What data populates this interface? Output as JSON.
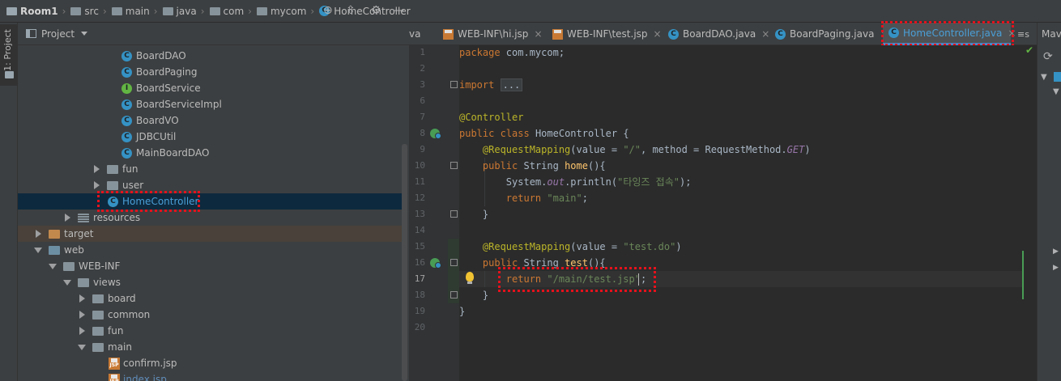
{
  "breadcrumb": [
    "Room1",
    "src",
    "main",
    "java",
    "com",
    "mycom",
    "HomeController"
  ],
  "left_stripe": {
    "tab_label": "1: Project"
  },
  "project_panel": {
    "title": "Project",
    "tree": [
      {
        "label": "BoardDAO",
        "icon": "class-icon"
      },
      {
        "label": "BoardPaging",
        "icon": "class-icon"
      },
      {
        "label": "BoardService",
        "icon": "interface-icon"
      },
      {
        "label": "BoardServiceImpl",
        "icon": "class-icon"
      },
      {
        "label": "BoardVO",
        "icon": "class-icon"
      },
      {
        "label": "JDBCUtil",
        "icon": "class-icon"
      },
      {
        "label": "MainBoardDAO",
        "icon": "class-icon"
      },
      {
        "label": "fun",
        "icon": "folder-icon"
      },
      {
        "label": "user",
        "icon": "folder-icon"
      },
      {
        "label": "HomeController",
        "icon": "class-icon"
      },
      {
        "label": "resources",
        "icon": "resources-folder-icon"
      },
      {
        "label": "target",
        "icon": "folder-icon"
      },
      {
        "label": "web",
        "icon": "web-folder-icon"
      },
      {
        "label": "WEB-INF",
        "icon": "folder-icon"
      },
      {
        "label": "views",
        "icon": "folder-icon"
      },
      {
        "label": "board",
        "icon": "folder-icon"
      },
      {
        "label": "common",
        "icon": "folder-icon"
      },
      {
        "label": "fun",
        "icon": "folder-icon"
      },
      {
        "label": "main",
        "icon": "folder-icon"
      },
      {
        "label": "confirm.jsp",
        "icon": "jsp-icon"
      },
      {
        "label": "index.jsp",
        "icon": "jsp-icon"
      }
    ]
  },
  "tabs": [
    {
      "label": "va"
    },
    {
      "label": "WEB-INF\\hi.jsp"
    },
    {
      "label": "WEB-INF\\test.jsp"
    },
    {
      "label": "BoardDAO.java"
    },
    {
      "label": "BoardPaging.java"
    },
    {
      "label": "HomeController.java"
    }
  ],
  "tabs_overflow": "≡s",
  "right_stripe": {
    "title": "Mave"
  },
  "editor": {
    "line_numbers": [
      "1",
      "2",
      "3",
      "6",
      "7",
      "8",
      "9",
      "10",
      "11",
      "12",
      "13",
      "14",
      "15",
      "16",
      "17",
      "18",
      "19",
      "20"
    ],
    "code": {
      "l1_kw": "package",
      "l1_rest": " com.mycom;",
      "l3_kw": "import",
      "l3_collapsed": "...",
      "l7_ann": "@Controller",
      "l8_kw1": "public",
      "l8_kw2": "class",
      "l8_rest": " HomeController {",
      "l9_ann": "@RequestMapping",
      "l9_a": "(value = ",
      "l9_str": "\"/\"",
      "l9_b": ", method = RequestMethod.",
      "l9_it": "GET",
      "l9_c": ")",
      "l10_kw": "public",
      "l10_a": " String ",
      "l10_fn": "home",
      "l10_b": "(){",
      "l11_a": "System.",
      "l11_it": "out",
      "l11_b": ".println(",
      "l11_str": "\"타잉즈 접속\"",
      "l11_c": ");",
      "l12_kw": "return",
      "l12_str": "\"main\"",
      "l12_c": ";",
      "l13": "}",
      "l15_ann": "@RequestMapping",
      "l15_a": "(value = ",
      "l15_str": "\"test.do\"",
      "l15_b": ")",
      "l16_kw": "public",
      "l16_a": " String ",
      "l16_fn": "test",
      "l16_b": "(){",
      "l17_kw": "return",
      "l17_str": "\"/main/test.jsp\"",
      "l17_c": ";",
      "l18": "}",
      "l19": "}"
    }
  }
}
